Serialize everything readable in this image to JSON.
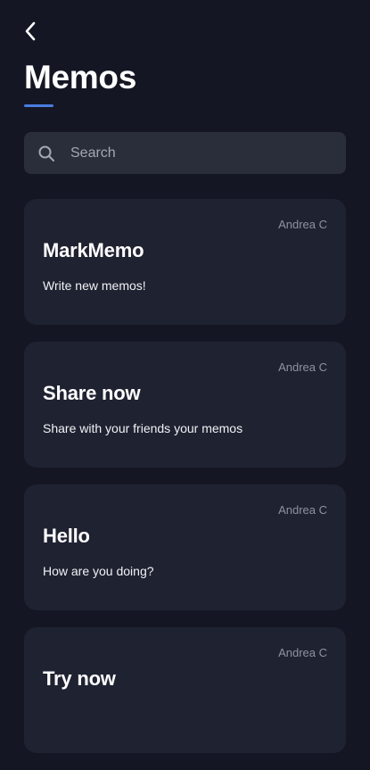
{
  "header": {
    "back_icon": "chevron-left-icon",
    "title": "Memos"
  },
  "search": {
    "placeholder": "Search",
    "icon": "search-icon"
  },
  "memos": [
    {
      "author": "Andrea C",
      "title": "MarkMemo",
      "body": "Write new memos!"
    },
    {
      "author": "Andrea C",
      "title": "Share now",
      "body": "Share with your friends your memos"
    },
    {
      "author": "Andrea C",
      "title": "Hello",
      "body": "How are you doing?"
    },
    {
      "author": "Andrea C",
      "title": "Try now",
      "body": ""
    }
  ],
  "colors": {
    "background": "#141723",
    "card": "#1f2231",
    "search_bg": "#2a2e3b",
    "accent": "#4a7ce0"
  }
}
